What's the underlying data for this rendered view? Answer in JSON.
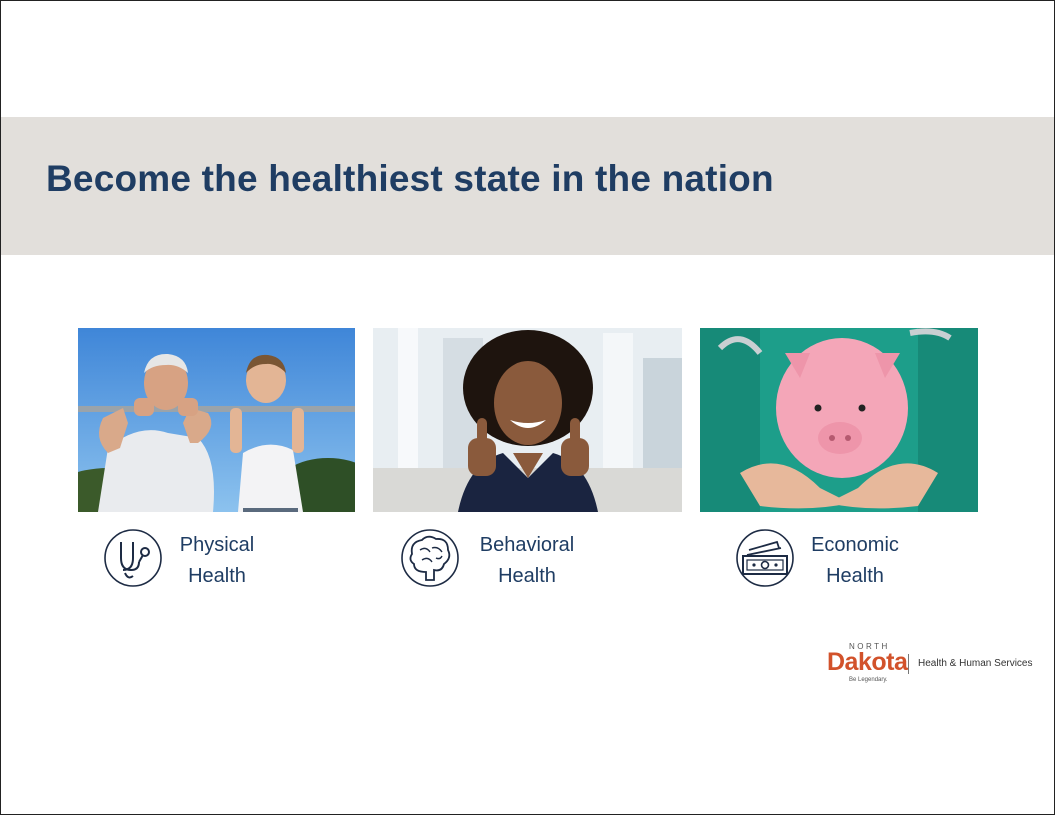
{
  "slide": {
    "title": "Become the healthiest state in the nation"
  },
  "pillars": [
    {
      "icon": "stethoscope-icon",
      "caption": "Physical\nHealth",
      "photo": "man-and-boy-pull-ups-photo"
    },
    {
      "icon": "brain-icon",
      "caption": "Behavioral\nHealth",
      "photo": "smiling-woman-thumbs-up-photo"
    },
    {
      "icon": "money-icon",
      "caption": "Economic\nHealth",
      "photo": "piggy-bank-in-hands-photo"
    }
  ],
  "logo": {
    "state_small": "NORTH",
    "state_main": "Dakota",
    "tagline": "Be Legendary.",
    "department": "Health & Human Services"
  },
  "colors": {
    "title": "#1f3d63",
    "band": "#e2dfdb",
    "logo_accent": "#d2522b"
  }
}
